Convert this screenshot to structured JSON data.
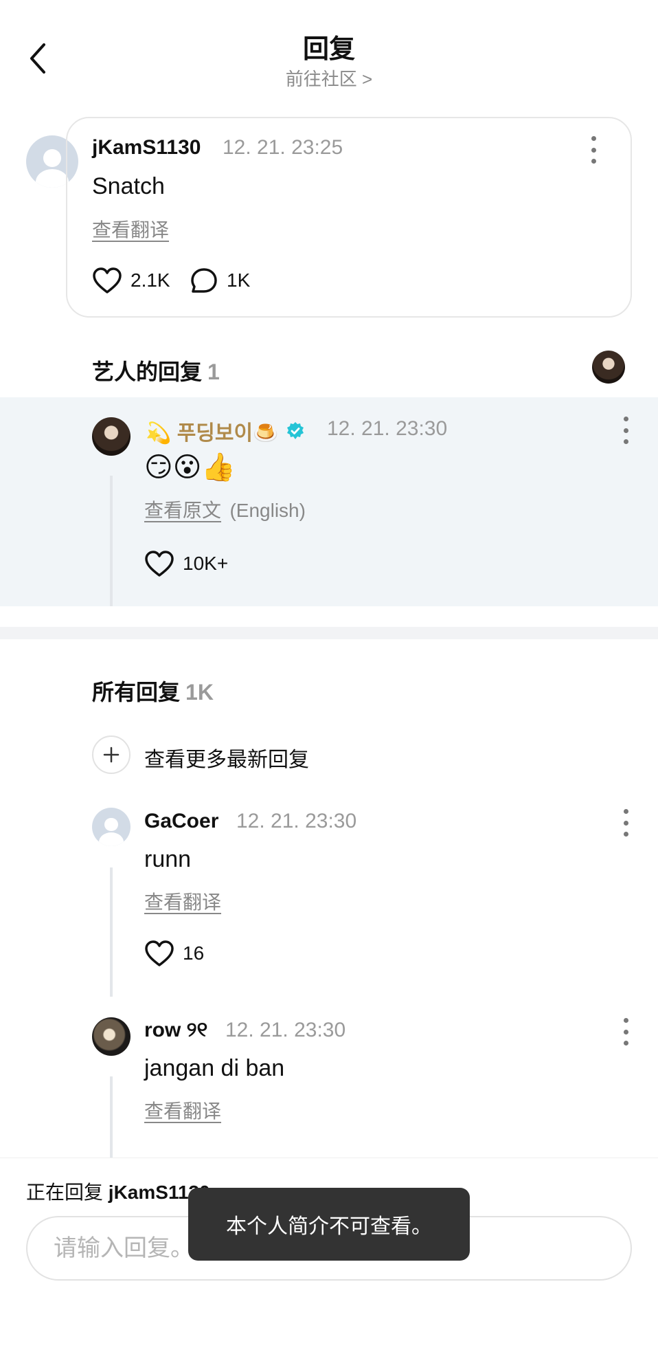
{
  "header": {
    "title": "回复",
    "subtitle": "前往社区 >"
  },
  "original_comment": {
    "username": "jKamS1130",
    "timestamp": "12. 21. 23:25",
    "text": "Snatch",
    "translate_label": "查看翻译",
    "likes": "2.1K",
    "replies": "1K"
  },
  "artist_section": {
    "title": "艺人的回复",
    "count": "1",
    "reply": {
      "name": "💫 푸딩보이🍮",
      "timestamp": "12. 21. 23:30",
      "emojis": "😏😮👍",
      "view_original": "查看原文",
      "language": "(English)",
      "likes": "10K+"
    }
  },
  "all_replies": {
    "title": "所有回复",
    "count": "1K",
    "more_label": "查看更多最新回复",
    "items": [
      {
        "username": "GaCoer",
        "timestamp": "12. 21. 23:30",
        "text": "runn",
        "translate_label": "查看翻译",
        "likes": "16"
      },
      {
        "username": "row ୨୧",
        "timestamp": "12. 21. 23:30",
        "text": "jangan di ban",
        "translate_label": "查看翻译"
      }
    ]
  },
  "composer": {
    "replying_prefix": "正在回复",
    "replying_to": "jKamS1130",
    "placeholder": "请输入回复。"
  },
  "toast": {
    "message": "本个人简介不可查看。"
  },
  "colors": {
    "verified": "#25c4d6",
    "artist_name": "#b08a4a",
    "artist_bg": "#f1f5f8"
  }
}
